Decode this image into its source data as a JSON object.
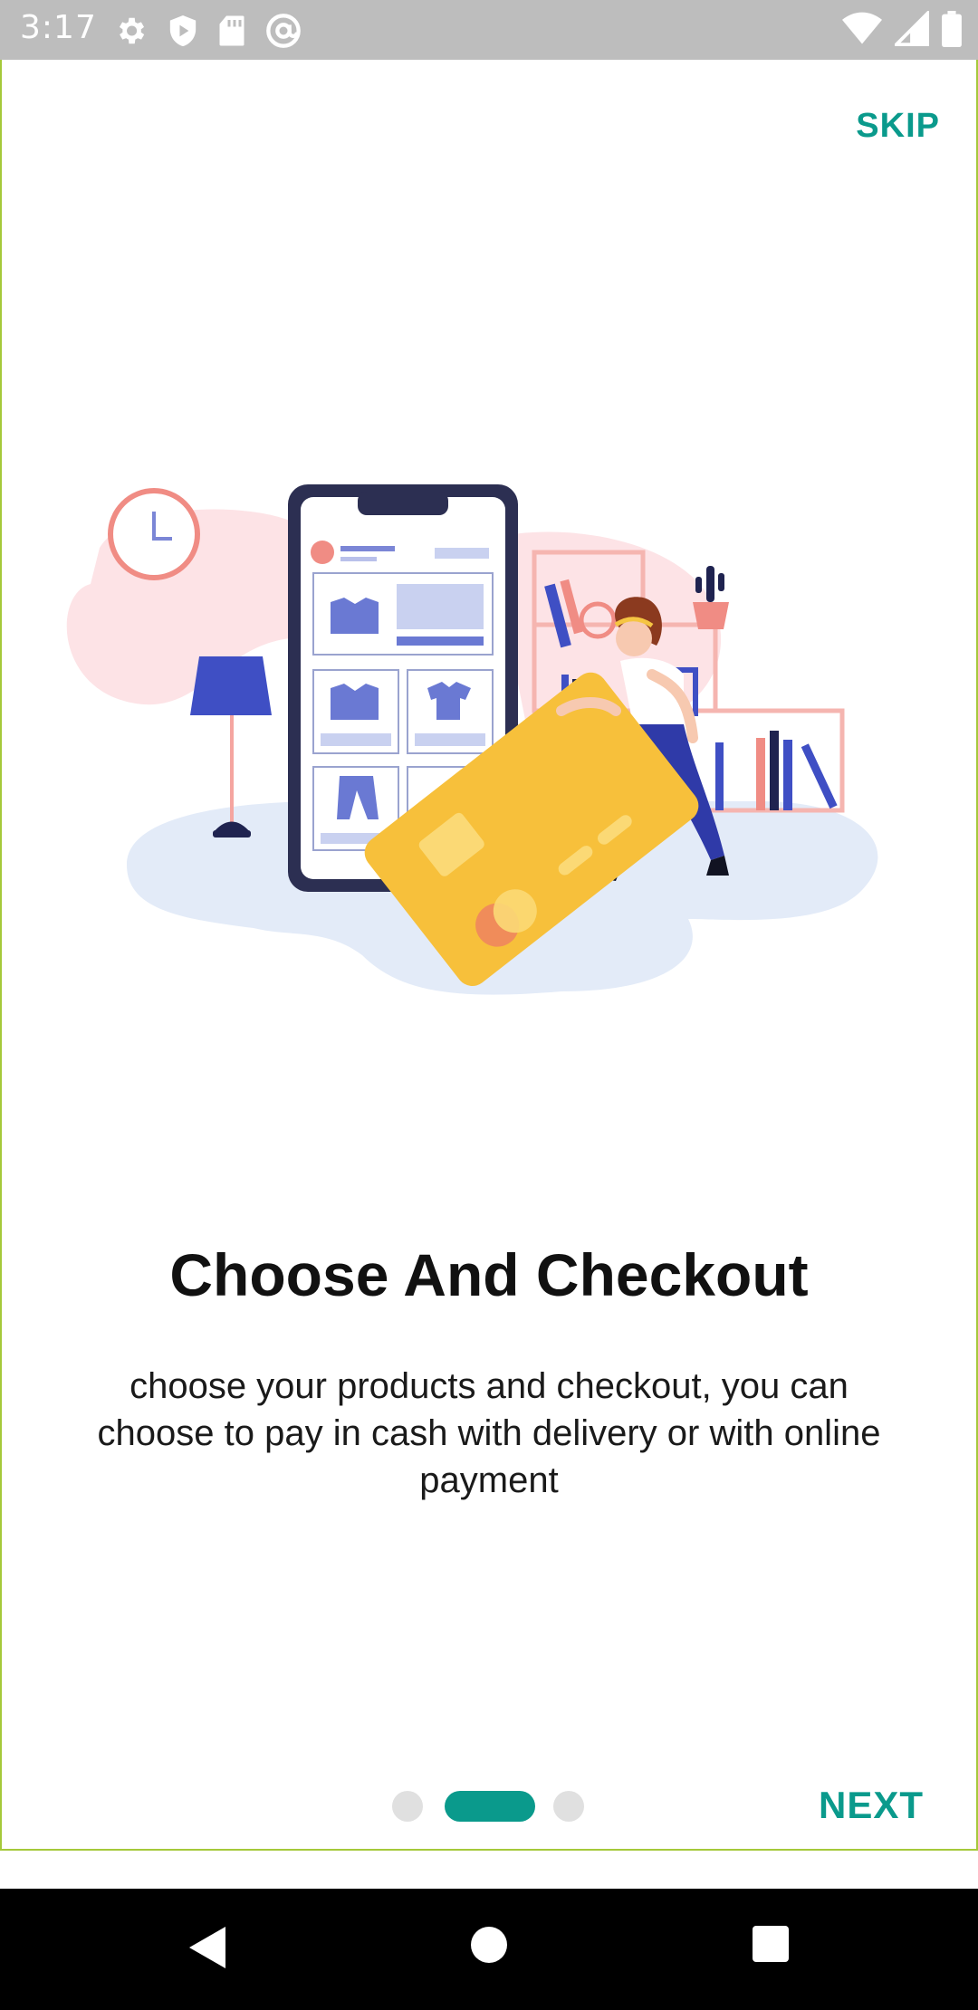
{
  "status_bar": {
    "time": "3:17",
    "left_icons": [
      "settings-icon",
      "shield-play-icon",
      "sd-card-icon",
      "at-sign-icon"
    ],
    "right_icons": [
      "wifi-icon",
      "signal-icon",
      "battery-icon"
    ]
  },
  "header": {
    "skip_label": "SKIP"
  },
  "content": {
    "title": "Choose And Checkout",
    "description": "choose your products and checkout, you can choose to pay in cash with delivery or with online payment"
  },
  "pager": {
    "page_count": 3,
    "active_index": 1,
    "active_color": "#0a9a8c",
    "inactive_color": "#e0e0e0"
  },
  "footer": {
    "next_label": "NEXT"
  },
  "nav_bar": {
    "buttons": [
      "back-icon",
      "home-icon",
      "recents-icon"
    ]
  },
  "colors": {
    "accent": "#0a9a8c",
    "frame": "#a5c93a"
  }
}
